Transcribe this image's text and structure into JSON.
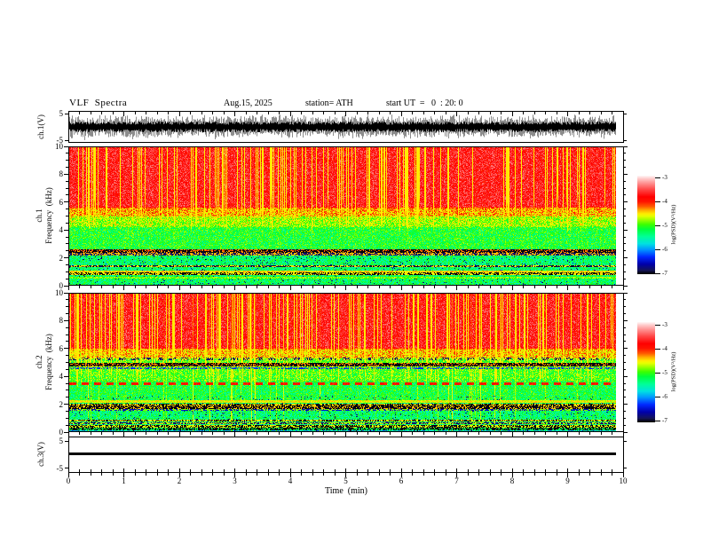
{
  "header": {
    "title": "VLF  Spectra",
    "date": "Aug.15, 2025",
    "station": "station= ATH",
    "start_ut": "start UT  =   0  : 20: 0"
  },
  "axes": {
    "time": {
      "label": "Time  (min)",
      "tick_labels": [
        "0",
        "1",
        "2",
        "3",
        "4",
        "5",
        "6",
        "7",
        "8",
        "9",
        "10"
      ],
      "min": 0,
      "max": 10,
      "minor_step_min": 0.2
    },
    "wave1": {
      "ylabel": "ch.1(V)",
      "tick_labels": [
        "5",
        "-5"
      ],
      "tick_values": [
        5,
        -5
      ]
    },
    "spec1": {
      "ylabel_channel": "ch.1",
      "ylabel_freq": "Frequency  (kHz)",
      "tick_labels": [
        "10",
        "8",
        "6",
        "4",
        "2",
        "0"
      ],
      "tick_values": [
        10,
        8,
        6,
        4,
        2,
        0
      ],
      "minor_step_khz": 0.5
    },
    "spec2": {
      "ylabel_channel": "ch.2",
      "ylabel_freq": "Frequency  (kHz)",
      "tick_labels": [
        "10",
        "8",
        "6",
        "4",
        "2",
        "0"
      ],
      "tick_values": [
        10,
        8,
        6,
        4,
        2,
        0
      ],
      "minor_step_khz": 0.5
    },
    "wave3": {
      "ylabel": "ch.3(V)",
      "tick_labels": [
        "5",
        "-5"
      ],
      "tick_values": [
        5,
        -5
      ]
    }
  },
  "colorbar": {
    "label": "log(PSD)(V²/Hz)",
    "tick_labels": [
      "-3",
      "-4",
      "-5",
      "-6",
      "-7"
    ],
    "tick_values": [
      -3,
      -4,
      -5,
      -6,
      -7
    ],
    "vmax": -2.9,
    "vmin": -7
  },
  "colormap": [
    [
      -7.0,
      0,
      0,
      0
    ],
    [
      -6.85,
      20,
      20,
      90
    ],
    [
      -6.6,
      0,
      0,
      170
    ],
    [
      -6.3,
      0,
      40,
      255
    ],
    [
      -6.0,
      0,
      150,
      255
    ],
    [
      -5.75,
      0,
      225,
      225
    ],
    [
      -5.45,
      0,
      255,
      150
    ],
    [
      -5.15,
      0,
      255,
      60
    ],
    [
      -4.95,
      60,
      255,
      0
    ],
    [
      -4.75,
      160,
      255,
      0
    ],
    [
      -4.6,
      230,
      255,
      0
    ],
    [
      -4.5,
      255,
      235,
      0
    ],
    [
      -4.35,
      255,
      170,
      0
    ],
    [
      -4.2,
      255,
      90,
      0
    ],
    [
      -4.0,
      255,
      20,
      0
    ],
    [
      -3.8,
      255,
      0,
      0
    ],
    [
      -3.5,
      255,
      70,
      70
    ],
    [
      -3.25,
      255,
      140,
      140
    ],
    [
      -3.05,
      255,
      200,
      200
    ],
    [
      -2.9,
      255,
      255,
      255
    ]
  ],
  "chart_data": [
    {
      "id": "ch1-waveform",
      "type": "line",
      "panel": "wave1",
      "ylabel": "ch.1(V)",
      "ylim": [
        -6,
        6
      ],
      "yticks": [
        5,
        -5
      ],
      "xlim": [
        0,
        10
      ],
      "data_end_min": 9.85,
      "description": "dense broadband noise trace, mean 0 V, envelope about ±5 V",
      "amplitude_V": 5,
      "mean_V": 0
    },
    {
      "id": "ch1-spectrogram",
      "type": "heatmap",
      "panel": "spec1",
      "ylabel": "ch.1 Frequency (kHz)",
      "ylim": [
        0,
        10
      ],
      "yticks": [
        10,
        8,
        6,
        4,
        2,
        0
      ],
      "xlim": [
        0,
        10
      ],
      "data_end_min": 9.85,
      "psd_log_range": [
        -3,
        -7
      ],
      "bands": [
        [
          5.6,
          10,
          -3.7
        ],
        [
          5.0,
          5.6,
          -4.35
        ],
        [
          4.2,
          5.0,
          -4.75
        ],
        [
          2.6,
          4.2,
          -5.1
        ],
        [
          1.0,
          2.6,
          -5.3
        ],
        [
          0,
          1.0,
          -5.25
        ]
      ],
      "lines": [
        {
          "f": 2.5,
          "hw": 0.08,
          "la": -7.0,
          "lb": -4.2,
          "p": 0.6
        },
        {
          "f": 2.36,
          "hw": 0.07,
          "la": -7.0,
          "lb": -4.3,
          "p": 0.7
        },
        {
          "f": 2.22,
          "hw": 0.05,
          "la": -6.8,
          "lb": -4.4,
          "p": 0.5
        },
        {
          "f": 1.35,
          "hw": 0.05,
          "la": -6.9,
          "lb": -4.5,
          "p": 0.55
        },
        {
          "f": 0.93,
          "hw": 0.08,
          "la": -4.35,
          "lb": -4.6,
          "p": 0.5
        },
        {
          "f": 0.8,
          "hw": 0.05,
          "la": -7.0,
          "lb": -4.5,
          "p": 0.5
        },
        {
          "f": 0.5,
          "hw": 0.04,
          "la": -4.7,
          "lb": -5.0,
          "p": 0.5
        }
      ],
      "streaks": {
        "prob": 0.2,
        "boost": [
          0.4,
          1.5
        ],
        "floor_kHz": [
          3.5,
          5.0
        ],
        "full_prob": 0.0
      }
    },
    {
      "id": "ch2-spectrogram",
      "type": "heatmap",
      "panel": "spec2",
      "ylabel": "ch.2 Frequency (kHz)",
      "ylim": [
        0,
        10
      ],
      "yticks": [
        10,
        8,
        6,
        4,
        2,
        0
      ],
      "xlim": [
        0,
        10
      ],
      "data_end_min": 9.85,
      "psd_log_range": [
        -3,
        -7
      ],
      "bands": [
        [
          6.0,
          10,
          -3.7
        ],
        [
          5.3,
          6.0,
          -4.4
        ],
        [
          3.6,
          5.3,
          -4.95
        ],
        [
          2.2,
          3.6,
          -5.15
        ],
        [
          0.3,
          2.2,
          -5.3
        ],
        [
          0,
          0.3,
          -5.7
        ]
      ],
      "lines": [
        {
          "f": 5.25,
          "hw": 0.06,
          "la": -6.8,
          "lb": -4.6,
          "p": 0.5,
          "dash": 1
        },
        {
          "f": 4.85,
          "hw": 0.08,
          "la": -7.0,
          "lb": -4.3,
          "p": 0.65
        },
        {
          "f": 4.6,
          "hw": 0.04,
          "la": -6.3,
          "lb": -4.8,
          "p": 0.5
        },
        {
          "f": 3.45,
          "hw": 0.05,
          "la": -4.0,
          "lb": -4.0,
          "p": 1,
          "dash": 1
        },
        {
          "f": 2.15,
          "hw": 0.05,
          "la": -4.45,
          "lb": -4.7,
          "p": 0.5
        },
        {
          "f": 1.92,
          "hw": 0.05,
          "la": -7.0,
          "lb": -4.5,
          "p": 0.55
        },
        {
          "f": 1.74,
          "hw": 0.07,
          "la": -7.0,
          "lb": -4.4,
          "p": 0.65
        },
        {
          "f": 1.55,
          "hw": 0.04,
          "la": -6.5,
          "lb": -4.8,
          "p": 0.45
        },
        {
          "f": 0.78,
          "hw": 0.05,
          "la": -7.0,
          "lb": -4.6,
          "p": 0.45
        },
        {
          "f": 0.57,
          "hw": 0.05,
          "la": -6.8,
          "lb": -4.7,
          "p": 0.5
        },
        {
          "f": 0.36,
          "hw": 0.05,
          "la": -7.0,
          "lb": -4.6,
          "p": 0.5
        },
        {
          "f": 0.14,
          "hw": 0.06,
          "la": -7.0,
          "lb": -5.2,
          "p": 0.6
        }
      ],
      "streaks": {
        "prob": 0.22,
        "boost": [
          0.4,
          1.4
        ],
        "floor_kHz": [
          2.8,
          5.0
        ],
        "full_prob": 0.05
      }
    },
    {
      "id": "ch3-waveform",
      "type": "line",
      "panel": "wave3",
      "ylabel": "ch.3(V)",
      "ylim": [
        -6.7,
        6.7
      ],
      "yticks": [
        5,
        -5
      ],
      "xlim": [
        0,
        10
      ],
      "data_end_min": 9.85,
      "description": "constant flat line at 0 V",
      "amplitude_V": 0,
      "mean_V": 0
    }
  ]
}
